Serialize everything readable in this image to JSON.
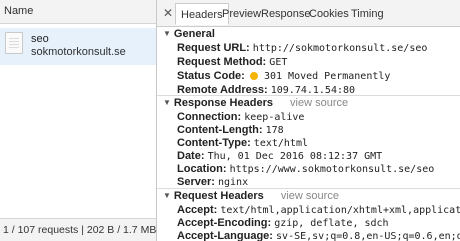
{
  "left_panel": {
    "header": "Name",
    "request": {
      "name": "seo",
      "domain": "sokmotorkonsult.se"
    },
    "status_bar": "1 / 107 requests  |  202 B / 1.7 MB tr..."
  },
  "tabs": [
    "Headers",
    "Preview",
    "Response",
    "Cookies",
    "Timing"
  ],
  "active_tab": "Headers",
  "general": {
    "title": "General",
    "request_url_label": "Request URL:",
    "request_url": "http://sokmotorkonsult.se/seo",
    "request_method_label": "Request Method:",
    "request_method": "GET",
    "status_code_label": "Status Code:",
    "status_code": "301 Moved Permanently",
    "status_color": "#f5b400",
    "remote_address_label": "Remote Address:",
    "remote_address": "109.74.1.54:80"
  },
  "response_headers": {
    "title": "Response Headers",
    "view_source": "view source",
    "items": [
      {
        "k": "Connection:",
        "v": "keep-alive"
      },
      {
        "k": "Content-Length:",
        "v": "178"
      },
      {
        "k": "Content-Type:",
        "v": "text/html"
      },
      {
        "k": "Date:",
        "v": "Thu, 01 Dec 2016 08:12:37 GMT"
      },
      {
        "k": "Location:",
        "v": "https://www.sokmotorkonsult.se/seo"
      },
      {
        "k": "Server:",
        "v": "nginx"
      }
    ]
  },
  "request_headers": {
    "title": "Request Headers",
    "view_source": "view source",
    "items": [
      {
        "k": "Accept:",
        "v": "text/html,application/xhtml+xml,application/xml"
      },
      {
        "k": "Accept-Encoding:",
        "v": "gzip, deflate, sdch"
      },
      {
        "k": "Accept-Language:",
        "v": "sv-SE,sv;q=0.8,en-US;q=0.6,en;q=0.4"
      }
    ]
  }
}
